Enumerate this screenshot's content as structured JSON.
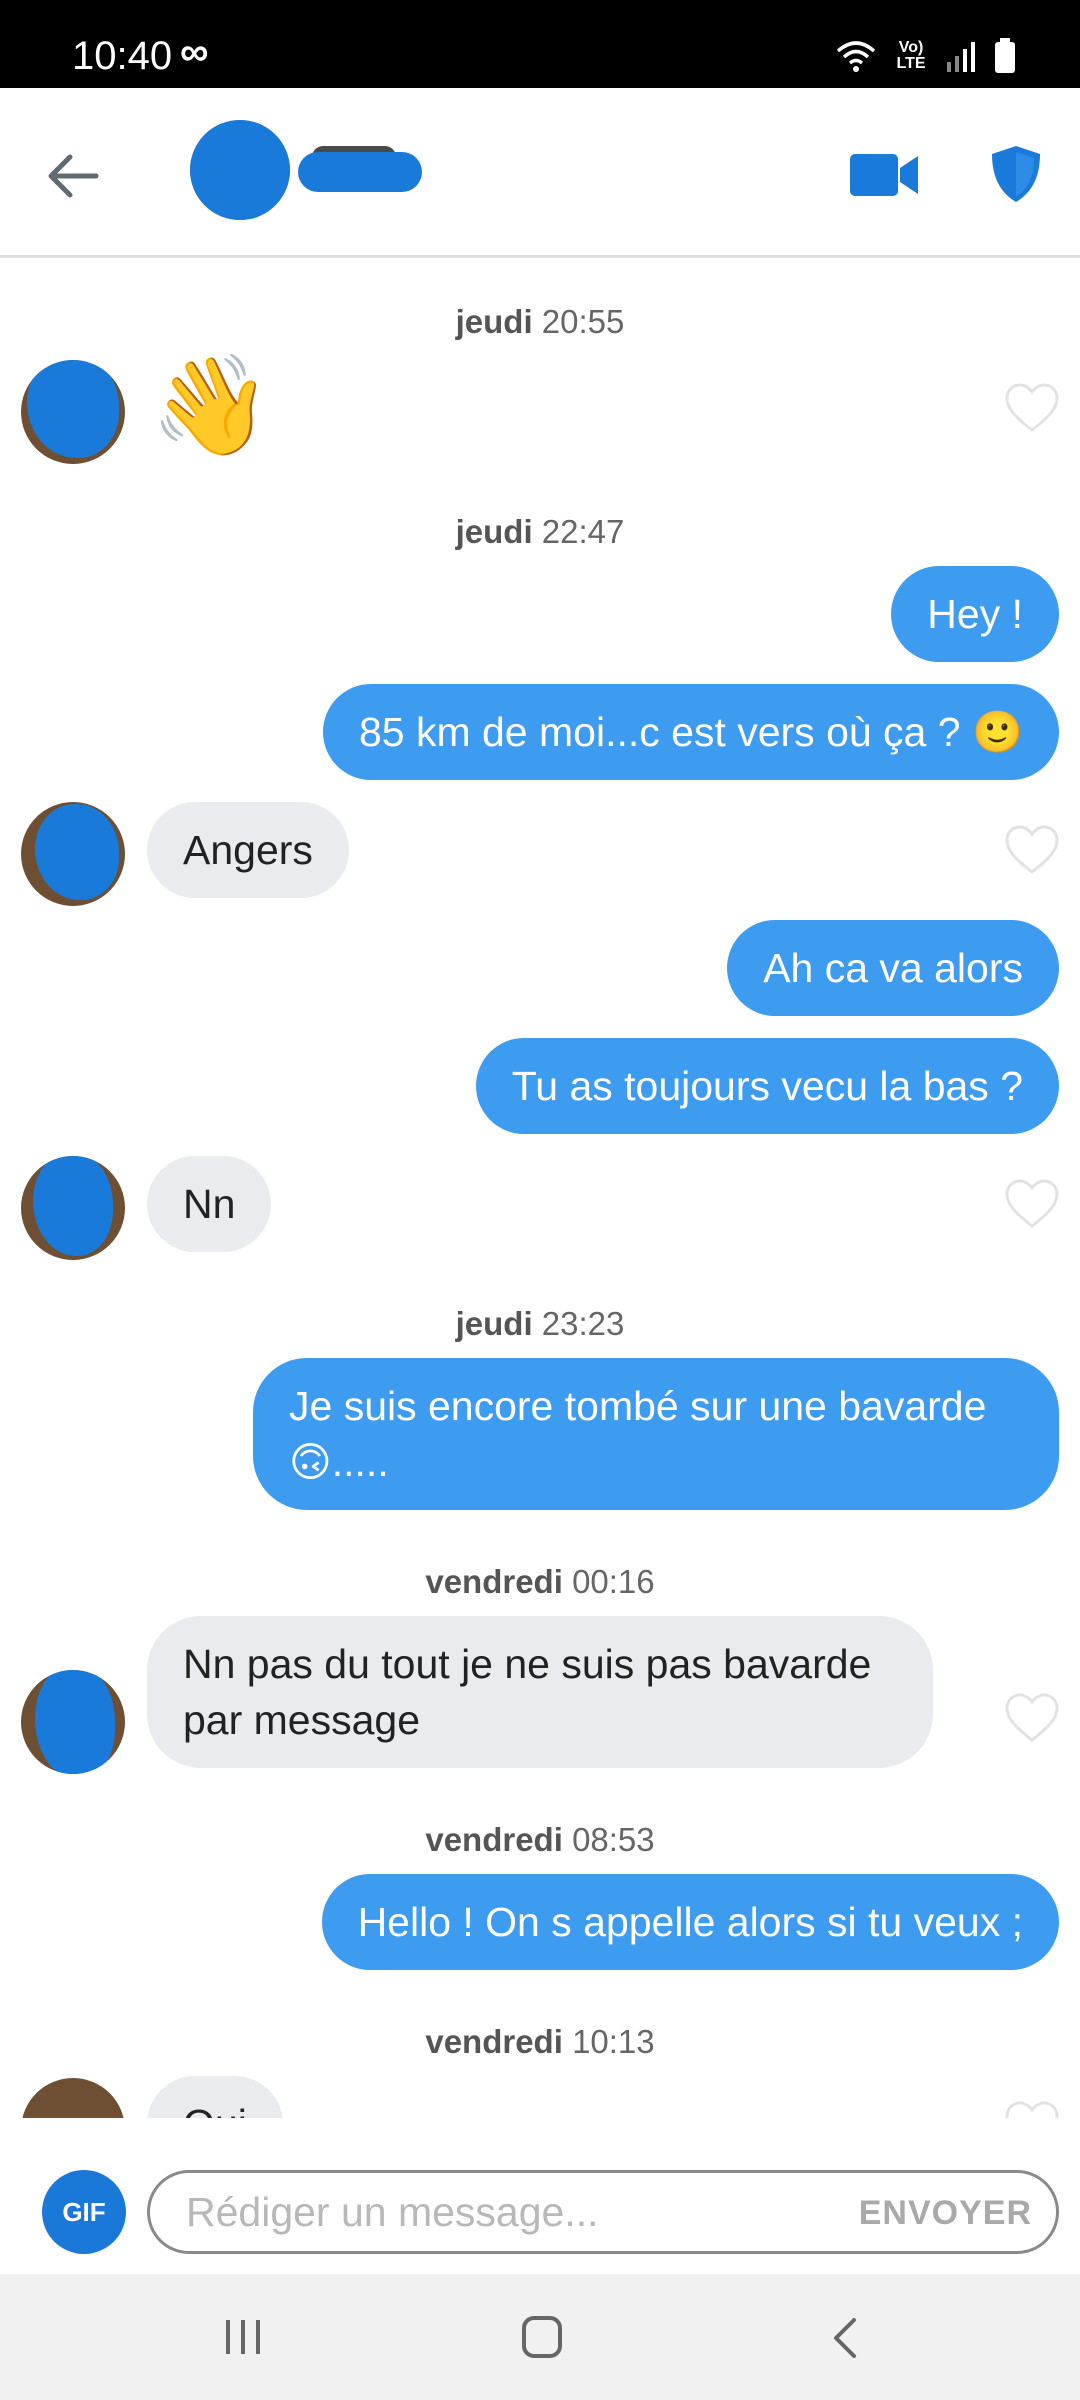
{
  "status_bar": {
    "time": "10:40",
    "infinity": "∞",
    "lte_top": "Vo)",
    "lte_bottom": "LTE"
  },
  "header": {
    "back_icon": "arrow-left-icon",
    "video_icon": "video-camera-icon",
    "shield_icon": "shield-icon",
    "accent_color": "#1a7ad9"
  },
  "messages": [
    {
      "type": "timestamp",
      "day": "jeudi",
      "time": "20:55"
    },
    {
      "type": "in",
      "text": "👋"
    },
    {
      "type": "timestamp",
      "day": "jeudi",
      "time": "22:47"
    },
    {
      "type": "out",
      "text": "Hey !"
    },
    {
      "type": "out",
      "text": "85 km de moi...c est vers où ça ? 🙂"
    },
    {
      "type": "in",
      "text": "Angers"
    },
    {
      "type": "out",
      "text": "Ah ca va alors"
    },
    {
      "type": "out",
      "text": "Tu as toujours vecu la bas ?"
    },
    {
      "type": "in",
      "text": "Nn"
    },
    {
      "type": "timestamp",
      "day": "jeudi",
      "time": "23:23"
    },
    {
      "type": "out",
      "text": "Je suis encore tombé sur une bavarde 🙃....."
    },
    {
      "type": "timestamp",
      "day": "vendredi",
      "time": "00:16"
    },
    {
      "type": "in",
      "text": "Nn pas du tout je ne suis pas bavarde par message"
    },
    {
      "type": "timestamp",
      "day": "vendredi",
      "time": "08:53"
    },
    {
      "type": "out",
      "text": "Hello ! On s appelle alors si tu veux ;"
    },
    {
      "type": "timestamp",
      "day": "vendredi",
      "time": "10:13"
    },
    {
      "type": "in",
      "text": "Oui"
    }
  ],
  "composer": {
    "gif_label": "GIF",
    "placeholder": "Rédiger un message...",
    "send_label": "ENVOYER"
  },
  "colors": {
    "outgoing_bubble": "#3d9bf0",
    "incoming_bubble": "#e9ebee",
    "gif_button": "#1a78d8"
  }
}
